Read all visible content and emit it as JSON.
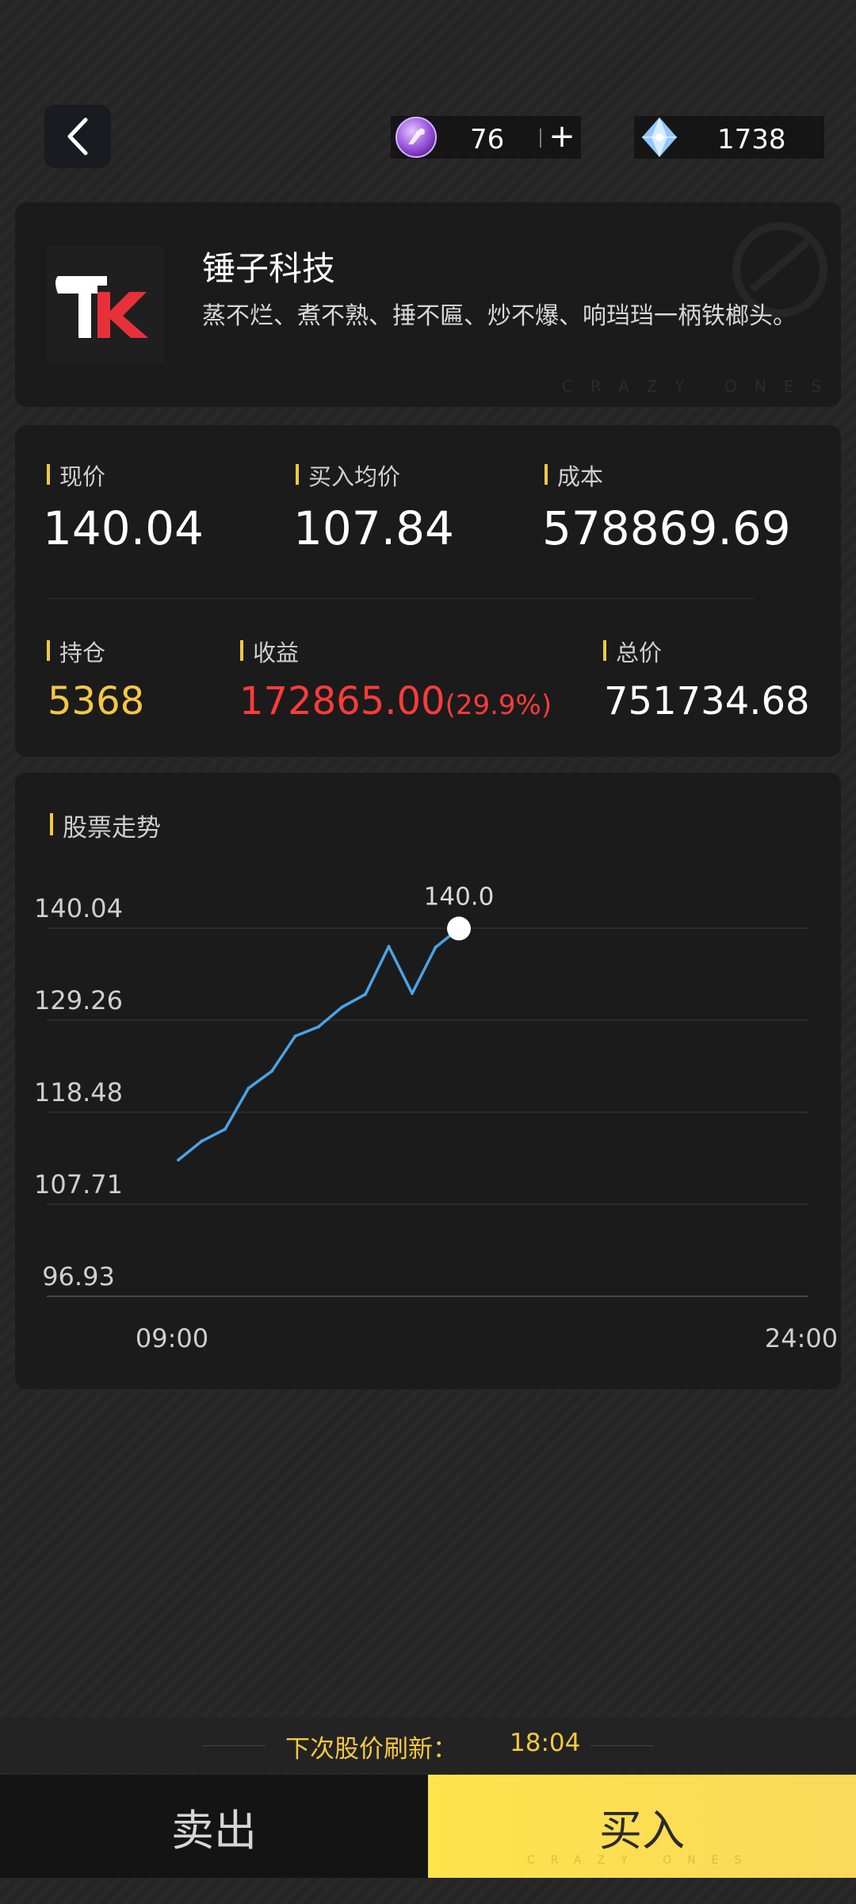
{
  "header": {
    "back_icon": "chevron-left-icon",
    "coin": {
      "icon": "purple-coin-icon",
      "value": "76",
      "add_label": "+"
    },
    "gem": {
      "icon": "blue-crystal-icon",
      "value": "1738"
    }
  },
  "company": {
    "name": "锤子科技",
    "description": "蒸不烂、煮不熟、捶不匾、炒不爆、响珰珰一柄铁榔头。",
    "logo_text": "TK",
    "watermark": "CRAZY ONES"
  },
  "stats": {
    "current_price_label": "现价",
    "current_price": "140.04",
    "avg_buy_label": "买入均价",
    "avg_buy": "107.84",
    "cost_label": "成本",
    "cost": "578869.69",
    "holdings_label": "持仓",
    "holdings": "5368",
    "profit_label": "收益",
    "profit": "172865.00",
    "profit_pct": "(29.9%)",
    "total_label": "总价",
    "total": "751734.68"
  },
  "chart_data": {
    "type": "line",
    "title": "股票走势",
    "xlabel": "",
    "ylabel": "",
    "x_tick_labels": [
      "09:00",
      "24:00"
    ],
    "y_tick_labels": [
      "140.04",
      "129.26",
      "118.48",
      "107.71",
      "96.93"
    ],
    "ylim": [
      96.93,
      140.04
    ],
    "grid": true,
    "last_point_label": "140.0",
    "series": [
      {
        "values": [
          112.9,
          115.1,
          116.5,
          121.3,
          123.3,
          127.4,
          128.5,
          130.8,
          132.3,
          137.9,
          132.4,
          137.8,
          140.0
        ]
      }
    ],
    "colors": {
      "line": "#4aa3e8",
      "grid": "#2f2f2f",
      "marker": "#ffffff"
    }
  },
  "footer": {
    "refresh_label": "下次股价刷新：",
    "refresh_time": "18:04",
    "sell_label": "卖出",
    "buy_label": "买入",
    "buy_watermark": "CRAZY ONES"
  },
  "colors": {
    "accent": "#f5c842",
    "profit": "#ff3b3b",
    "holdings": "#f5c842"
  }
}
